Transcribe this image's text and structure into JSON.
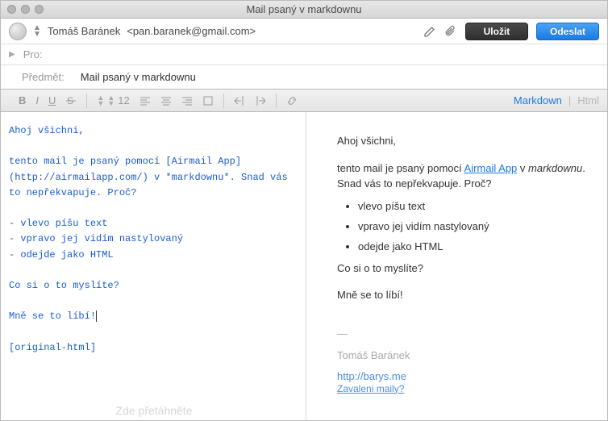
{
  "window": {
    "title": "Mail psaný v markdownu"
  },
  "from": {
    "name": "Tomáš Baránek",
    "email": "<pan.baranek@gmail.com>"
  },
  "buttons": {
    "save": "Uložit",
    "send": "Odeslat"
  },
  "to": {
    "label": "Pro:"
  },
  "subject": {
    "label": "Předmět:",
    "value": "Mail psaný v markdownu"
  },
  "toolbar": {
    "bold": "B",
    "italic": "I",
    "underline": "U",
    "fontsize": "12",
    "modes": {
      "markdown": "Markdown",
      "html": "Html",
      "sep": "|"
    }
  },
  "editor": {
    "l1": "Ahoj všichni,",
    "l2": "tento mail je psaný pomocí [Airmail App](http://airmailapp.com/) v *markdownu*. Snad vás to nepřekvapuje. Proč?",
    "b1": "- vlevo píšu text",
    "b2": "- vpravo jej vidím nastylovaný",
    "b3": "- odejde jako HTML",
    "l3": "Co si o to myslíte?",
    "l4": "Mně se to líbí!",
    "l5": "[original-html]"
  },
  "preview": {
    "p1": "Ahoj všichni,",
    "p2a": "tento mail je psaný pomocí ",
    "p2link": "Airmail App",
    "p2b": " v ",
    "p2em": "markdownu",
    "p2c": ". Snad vás to nepřekvapuje. Proč?",
    "li1": "vlevo píšu text",
    "li2": "vpravo jej vidím nastylovaný",
    "li3": "odejde jako HTML",
    "p3": "Co si o to myslíte?",
    "p4": "Mně se to líbí!",
    "sig_dash": "—",
    "sig_name": "Tomáš Baránek",
    "sig_url": "http://barys.me",
    "sig_tag": "Zavaleni maily?"
  },
  "dropzone": "Zde přetáhněte"
}
